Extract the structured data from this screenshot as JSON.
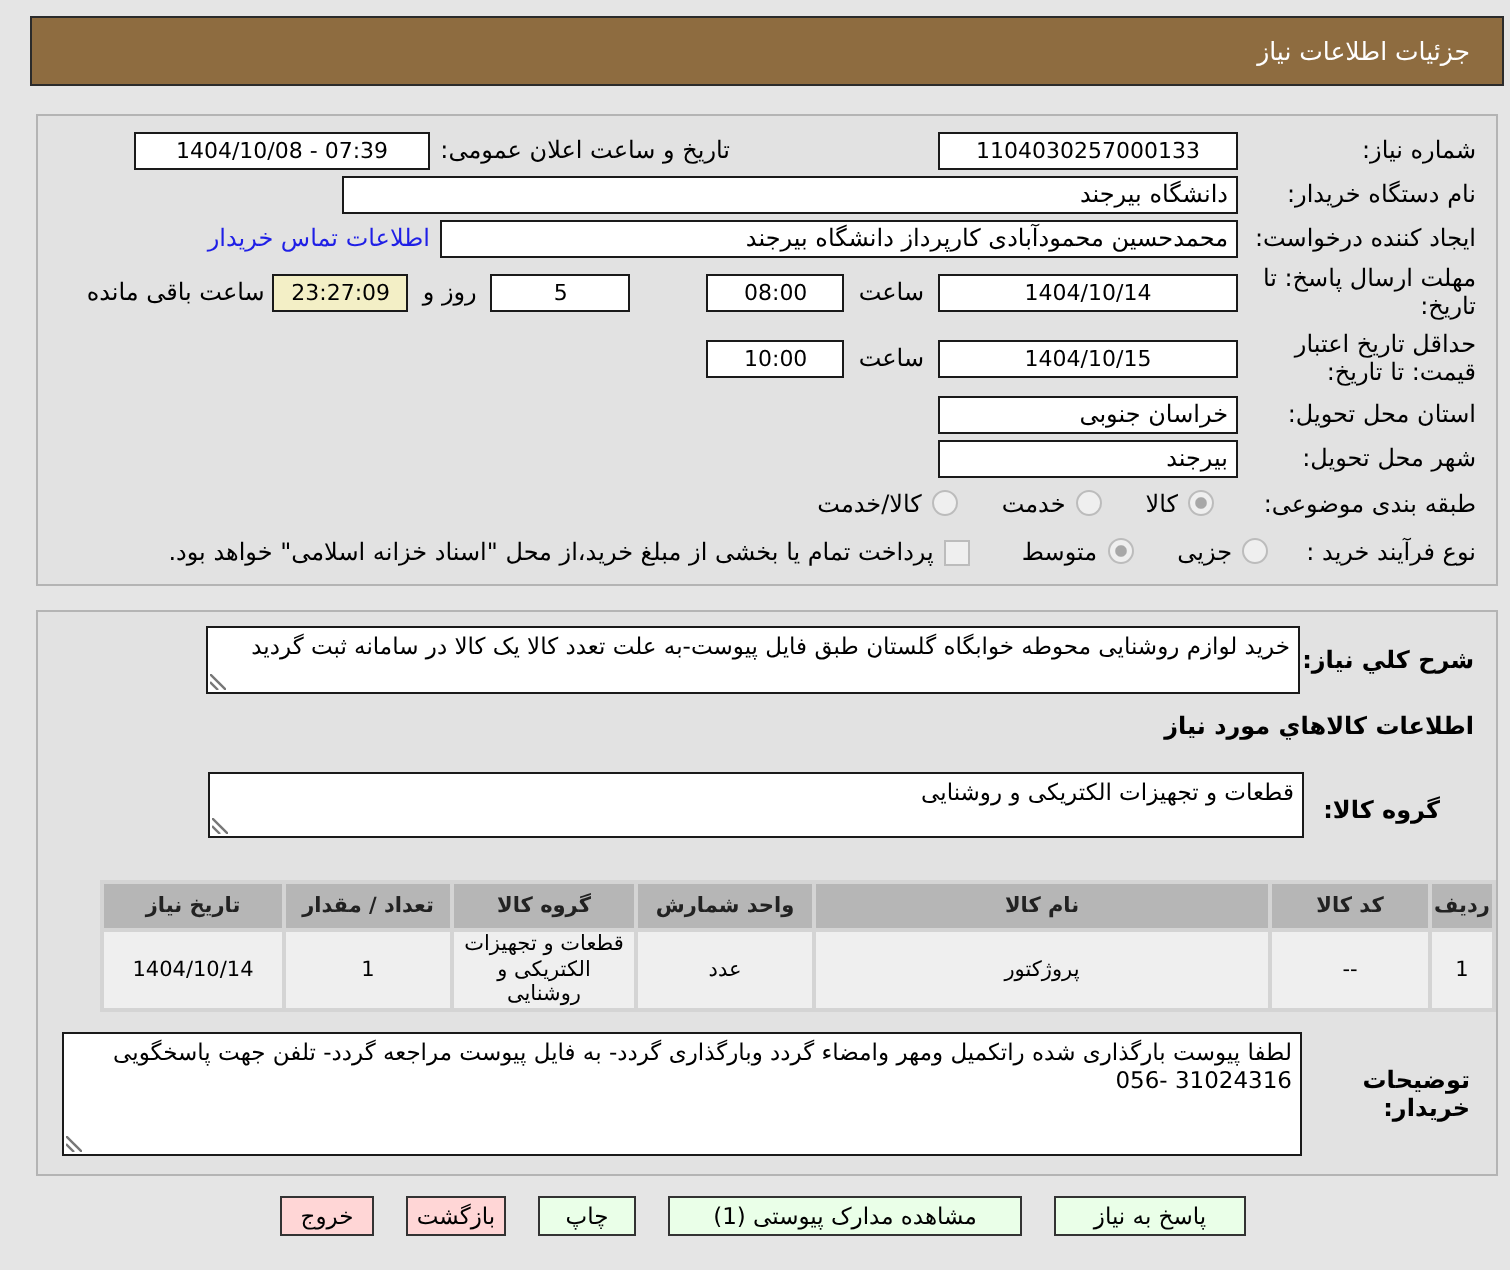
{
  "header": {
    "title": "جزئیات اطلاعات نیاز"
  },
  "details": {
    "need_number": {
      "label": "شماره نیاز:",
      "value": "1104030257000133"
    },
    "announce_datetime": {
      "label": "تاریخ و ساعت اعلان عمومی:",
      "value": "1404/10/08 - 07:39"
    },
    "buyer_org": {
      "label": "نام دستگاه خریدار:",
      "value": "دانشگاه بیرجند"
    },
    "requester": {
      "label": "ایجاد کننده درخواست:",
      "value": "محمدحسین محمودآبادی کارپرداز دانشگاه بیرجند",
      "link": "اطلاعات تماس خریدار"
    },
    "reply_deadline": {
      "label": "مهلت ارسال پاسخ: تا تاریخ:",
      "date": "1404/10/14",
      "time_label": "ساعت",
      "time": "08:00",
      "days": "5",
      "days_label": "روز و",
      "remaining": "23:27:09",
      "remaining_label": "ساعت باقی مانده"
    },
    "price_validity": {
      "label": "حداقل تاریخ اعتبار قیمت: تا تاریخ:",
      "date": "1404/10/15",
      "time_label": "ساعت",
      "time": "10:00"
    },
    "province": {
      "label": "استان محل تحویل:",
      "value": "خراسان جنوبی"
    },
    "city": {
      "label": "شهر محل تحویل:",
      "value": "بیرجند"
    },
    "category": {
      "label": "طبقه بندی موضوعی:",
      "disabled": true,
      "options": [
        {
          "label": "کالا",
          "selected": true
        },
        {
          "label": "خدمت",
          "selected": false
        },
        {
          "label": "کالا/خدمت",
          "selected": false
        }
      ]
    },
    "process": {
      "label": "نوع فرآیند خرید :",
      "disabled": true,
      "options": [
        {
          "label": "جزیی",
          "selected": false
        },
        {
          "label": "متوسط",
          "selected": true
        }
      ],
      "treasury": {
        "label": "پرداخت تمام یا بخشی از مبلغ خرید،از محل \"اسناد خزانه اسلامی\" خواهد بود.",
        "checked": false,
        "disabled": true
      }
    }
  },
  "needs": {
    "summary_label": "شرح کلي نياز:",
    "summary": "خرید لوازم روشنایی محوطه خوابگاه گلستان طبق فایل پیوست-به علت تعدد کالا یک کالا در سامانه ثبت گردید",
    "goods_title": "اطلاعات کالاهاي مورد نياز",
    "group_label": "گروه کالا:",
    "group": "قطعات و تجهیزات الکتریکی و روشنایی",
    "table": {
      "columns": [
        "ردیف",
        "کد کالا",
        "نام کالا",
        "واحد شمارش",
        "گروه کالا",
        "تعداد / مقدار",
        "تاریخ نیاز"
      ],
      "rows": [
        [
          "1",
          "--",
          "پروژکتور",
          "عدد",
          "قطعات و تجهیزات الکتریکی و روشنایی",
          "1",
          "1404/10/14"
        ]
      ]
    },
    "notes_label": "توضیحات خریدار:",
    "notes": "لطفا پیوست بارگذاری شده راتکمیل ومهر وامضاء گردد وبارگذاری گردد- به فایل پیوست مراجعه گردد- تلفن جهت پاسخگویی 31024316 -056"
  },
  "buttons": [
    {
      "label": "پاسخ به نیاز",
      "kind": "normal"
    },
    {
      "label": "مشاهده مدارک پیوستی (1)",
      "kind": "normal"
    },
    {
      "label": "چاپ",
      "kind": "normal"
    },
    {
      "label": "بازگشت",
      "kind": "cancel"
    },
    {
      "label": "خروج",
      "kind": "cancel"
    }
  ]
}
